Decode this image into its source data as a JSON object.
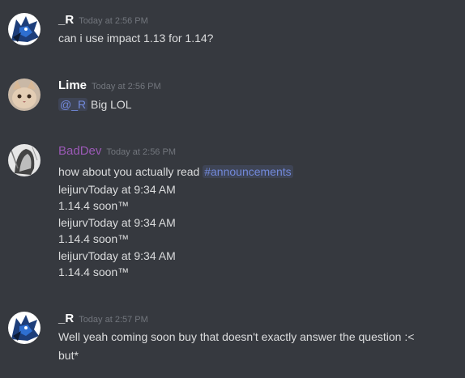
{
  "colors": {
    "background": "#36393f",
    "text": "#dcddde",
    "timestamp": "#72767d",
    "mention": "#7289da",
    "baddev_name": "#9b59b6"
  },
  "messages": [
    {
      "author": "_R",
      "timestamp": "Today at 2:56 PM",
      "avatar_icon": "wolf-avatar-icon",
      "lines": [
        "can i use impact 1.13 for 1.14?"
      ]
    },
    {
      "author": "Lime",
      "timestamp": "Today at 2:56 PM",
      "avatar_icon": "cat-avatar-icon",
      "mention": "@_R",
      "text_after_mention": "Big LOL"
    },
    {
      "author": "BadDev",
      "timestamp": "Today at 2:56 PM",
      "avatar_icon": "sketch-avatar-icon",
      "text_before_channel": "how about you actually read",
      "channel": "#announcements",
      "quoted": [
        {
          "header": "leijurvToday at 9:34 AM",
          "body": "1.14.4 soon™"
        },
        {
          "header": "leijurvToday at 9:34 AM",
          "body": "1.14.4 soon™"
        },
        {
          "header": "leijurvToday at 9:34 AM",
          "body": "1.14.4 soon™"
        }
      ]
    },
    {
      "author": "_R",
      "timestamp": "Today at 2:57 PM",
      "avatar_icon": "wolf-avatar-icon",
      "lines": [
        "Well yeah coming soon buy that doesn't exactly answer the question :<",
        "but*"
      ]
    }
  ]
}
